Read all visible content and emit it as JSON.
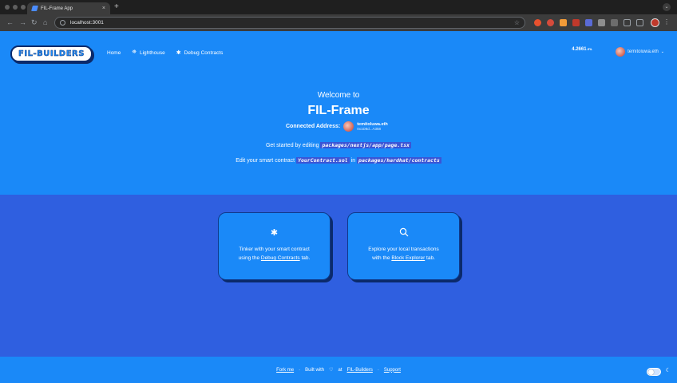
{
  "browser": {
    "tab_title": "FIL-Frame App",
    "tab_close": "×",
    "new_tab": "+",
    "url": "localhost:3001",
    "back": "←",
    "forward": "→",
    "reload": "↻",
    "home": "⌂",
    "star": "☆",
    "menu": "⋮",
    "chevron": "⌄"
  },
  "header": {
    "logo_text": "FIL-BUILDERS",
    "nav": [
      {
        "label": "Home",
        "icon": ""
      },
      {
        "label": "Lighthouse",
        "icon": "lighthouse-icon"
      },
      {
        "label": "Debug Contracts",
        "icon": "bug-icon"
      }
    ],
    "balance": "4.2661",
    "balance_unit": "tFIL",
    "account_name": "temitoluwa.eth",
    "caret": "⌄"
  },
  "hero": {
    "welcome": "Welcome to",
    "brand": "FIL-Frame",
    "connected_label": "Connected Address:",
    "ens_name": "temitoluwa.eth",
    "short_address": "0x1D8d...A358",
    "line1_prefix": "Get started by editing",
    "line1_code": "packages/nextjs/app/page.tsx",
    "line2_prefix": "Edit your smart contract",
    "line2_code1": "YourContract.sol",
    "line2_mid": "in",
    "line2_code2": "packages/hardhat/contracts"
  },
  "cards": [
    {
      "icon": "bug-icon",
      "glyph": "🐞",
      "line1": "Tinker with your smart contract",
      "pre": "using the",
      "link": "Debug Contracts",
      "post": "tab."
    },
    {
      "icon": "search-icon",
      "glyph": "⌕",
      "line1": "Explore your local transactions",
      "pre": "with the",
      "link": "Block Explorer",
      "post": "tab."
    }
  ],
  "footer": {
    "fork": "Fork me",
    "sep1": "·",
    "built_with": "Built with",
    "heart": "♡",
    "at": "at",
    "builders": "FIL-Builders",
    "sep2": "·",
    "support": "Support",
    "moon": "☾"
  },
  "colors": {
    "primary": "#1a89f8",
    "lower_section": "#2f5fe0",
    "shadow": "#0b2a6b"
  }
}
